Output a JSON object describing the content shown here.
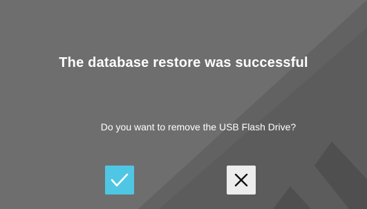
{
  "dialog": {
    "title": "The database restore was successful",
    "question": "Do you want to remove the USB Flash Drive?",
    "confirm_icon": "check-icon",
    "cancel_icon": "close-icon"
  },
  "colors": {
    "background": "#6e6e6e",
    "background_shade": "#5f5f5f",
    "confirm": "#4fc7e4",
    "cancel": "#ededed",
    "text": "#ffffff"
  }
}
